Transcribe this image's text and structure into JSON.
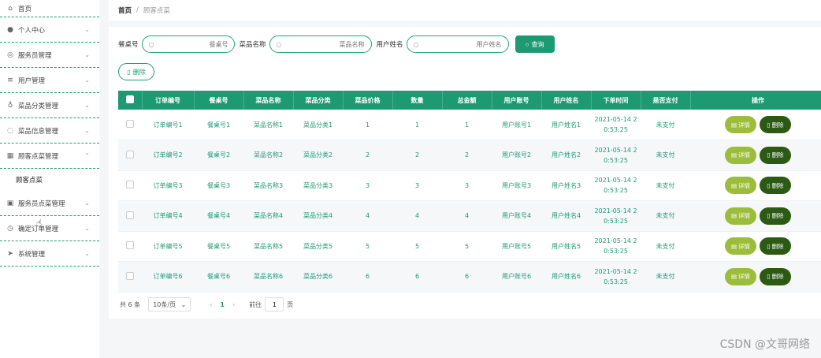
{
  "sidebar": {
    "items": [
      {
        "label": "首页",
        "icon": "home-icon",
        "glyph": "⌂",
        "chevron": false
      },
      {
        "label": "个人中心",
        "icon": "user-icon",
        "glyph": "●",
        "chevron": true
      },
      {
        "label": "服务员管理",
        "icon": "globe-icon",
        "glyph": "◎",
        "chevron": true
      },
      {
        "label": "用户管理",
        "icon": "list-icon",
        "glyph": "≡",
        "chevron": true
      },
      {
        "label": "菜品分类管理",
        "icon": "mic-icon",
        "glyph": "♁",
        "chevron": true
      },
      {
        "label": "菜品信息管理",
        "icon": "bulb-icon",
        "glyph": "◌",
        "chevron": true
      },
      {
        "label": "顾客点菜管理",
        "icon": "chart-icon",
        "glyph": "▦",
        "chevron": "up"
      },
      {
        "label": "服务员点菜管理",
        "icon": "store-icon",
        "glyph": "▣",
        "chevron": true
      },
      {
        "label": "确定订单管理",
        "icon": "clock-icon",
        "glyph": "◷",
        "chevron": true
      },
      {
        "label": "系统管理",
        "icon": "send-icon",
        "glyph": "➤",
        "chevron": true
      }
    ],
    "submenu": "顾客点菜"
  },
  "breadcrumb": {
    "home": "首页",
    "sep": "/",
    "current": "顾客点菜"
  },
  "search": {
    "table_label": "餐桌号",
    "table_placeholder": "餐桌号",
    "dish_label": "菜品名称",
    "dish_placeholder": "菜品名称",
    "user_label": "用户姓名",
    "user_placeholder": "用户姓名",
    "search_button": "查询",
    "delete_button": "删除"
  },
  "table": {
    "columns": [
      "订单编号",
      "餐桌号",
      "菜品名称",
      "菜品分类",
      "菜品价格",
      "数量",
      "总金额",
      "用户账号",
      "用户姓名",
      "下单时间",
      "是否支付",
      "操作"
    ],
    "rows": [
      {
        "order": "订单编号1",
        "table": "餐桌号1",
        "dish": "菜品名称1",
        "cat": "菜品分类1",
        "price": "1",
        "qty": "1",
        "total": "1",
        "account": "用户账号1",
        "name": "用户姓名1",
        "time1": "2021-05-14 2",
        "time2": "0:53:25",
        "paid": "未支付"
      },
      {
        "order": "订单编号2",
        "table": "餐桌号2",
        "dish": "菜品名称2",
        "cat": "菜品分类2",
        "price": "2",
        "qty": "2",
        "total": "2",
        "account": "用户账号2",
        "name": "用户姓名2",
        "time1": "2021-05-14 2",
        "time2": "0:53:25",
        "paid": "未支付"
      },
      {
        "order": "订单编号3",
        "table": "餐桌号3",
        "dish": "菜品名称3",
        "cat": "菜品分类3",
        "price": "3",
        "qty": "3",
        "total": "3",
        "account": "用户账号3",
        "name": "用户姓名3",
        "time1": "2021-05-14 2",
        "time2": "0:53:25",
        "paid": "未支付"
      },
      {
        "order": "订单编号4",
        "table": "餐桌号4",
        "dish": "菜品名称4",
        "cat": "菜品分类4",
        "price": "4",
        "qty": "4",
        "total": "4",
        "account": "用户账号4",
        "name": "用户姓名4",
        "time1": "2021-05-14 2",
        "time2": "0:53:25",
        "paid": "未支付"
      },
      {
        "order": "订单编号5",
        "table": "餐桌号5",
        "dish": "菜品名称5",
        "cat": "菜品分类5",
        "price": "5",
        "qty": "5",
        "total": "5",
        "account": "用户账号5",
        "name": "用户姓名5",
        "time1": "2021-05-14 2",
        "time2": "0:53:25",
        "paid": "未支付"
      },
      {
        "order": "订单编号6",
        "table": "餐桌号6",
        "dish": "菜品名称6",
        "cat": "菜品分类6",
        "price": "6",
        "qty": "6",
        "total": "6",
        "account": "用户账号6",
        "name": "用户姓名6",
        "time1": "2021-05-14 2",
        "time2": "0:53:25",
        "paid": "未支付"
      }
    ],
    "detail_button": "详情",
    "delete_button": "删除"
  },
  "pager": {
    "total": "共 6 条",
    "page_size": "10条/页",
    "current_page": "1",
    "goto_label": "前往",
    "goto_value": "1",
    "page_suffix": "页"
  },
  "watermark": "CSDN @文哥网络",
  "colors": {
    "accent": "#1e9a73",
    "detail": "#9cbd3b",
    "delete": "#2c5a14"
  }
}
